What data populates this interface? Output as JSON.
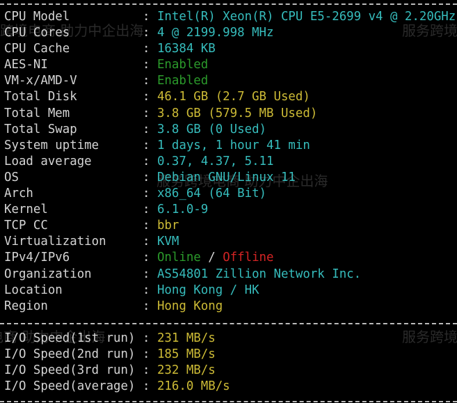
{
  "watermark": "服务跨境电商 助力中企出海",
  "system": [
    {
      "label": "CPU Model",
      "value": "Intel(R) Xeon(R) CPU E5-2699 v4 @ 2.20GHz",
      "color": "cyan"
    },
    {
      "label": "CPU Cores",
      "value": "4 @ 2199.998 MHz",
      "color": "cyan"
    },
    {
      "label": "CPU Cache",
      "value": "16384 KB",
      "color": "cyan"
    },
    {
      "label": "AES-NI",
      "value": "Enabled",
      "color": "green"
    },
    {
      "label": "VM-x/AMD-V",
      "value": "Enabled",
      "color": "green"
    },
    {
      "label": "Total Disk",
      "value": "46.1 GB (2.7 GB Used)",
      "color": "yellow"
    },
    {
      "label": "Total Mem",
      "value": "3.8 GB (579.5 MB Used)",
      "color": "yellow"
    },
    {
      "label": "Total Swap",
      "value": "3.8 GB (0 Used)",
      "color": "cyan"
    },
    {
      "label": "System uptime",
      "value": "1 days, 1 hour 41 min",
      "color": "cyan"
    },
    {
      "label": "Load average",
      "value": "0.37, 4.37, 5.11",
      "color": "cyan"
    },
    {
      "label": "OS",
      "value": "Debian GNU/Linux 11",
      "color": "cyan"
    },
    {
      "label": "Arch",
      "value": "x86_64 (64 Bit)",
      "color": "cyan"
    },
    {
      "label": "Kernel",
      "value": "6.1.0-9",
      "color": "cyan"
    },
    {
      "label": "TCP CC",
      "value": "bbr",
      "color": "yellow"
    },
    {
      "label": "Virtualization",
      "value": "KVM",
      "color": "cyan"
    }
  ],
  "ip": {
    "label": "IPv4/IPv6",
    "online": "Online",
    "slash": " / ",
    "offline": "Offline"
  },
  "location": [
    {
      "label": "Organization",
      "value": "AS54801 Zillion Network Inc.",
      "color": "cyan"
    },
    {
      "label": "Location",
      "value": "Hong Kong / HK",
      "color": "cyan"
    },
    {
      "label": "Region",
      "value": "Hong Kong",
      "color": "yellow"
    }
  ],
  "io": [
    {
      "label": "I/O Speed(1st run)",
      "value": "231 MB/s"
    },
    {
      "label": "I/O Speed(2nd run)",
      "value": "185 MB/s"
    },
    {
      "label": "I/O Speed(3rd run)",
      "value": "232 MB/s"
    },
    {
      "label": "I/O Speed(average)",
      "value": "216.0 MB/s"
    }
  ],
  "separator": ": "
}
